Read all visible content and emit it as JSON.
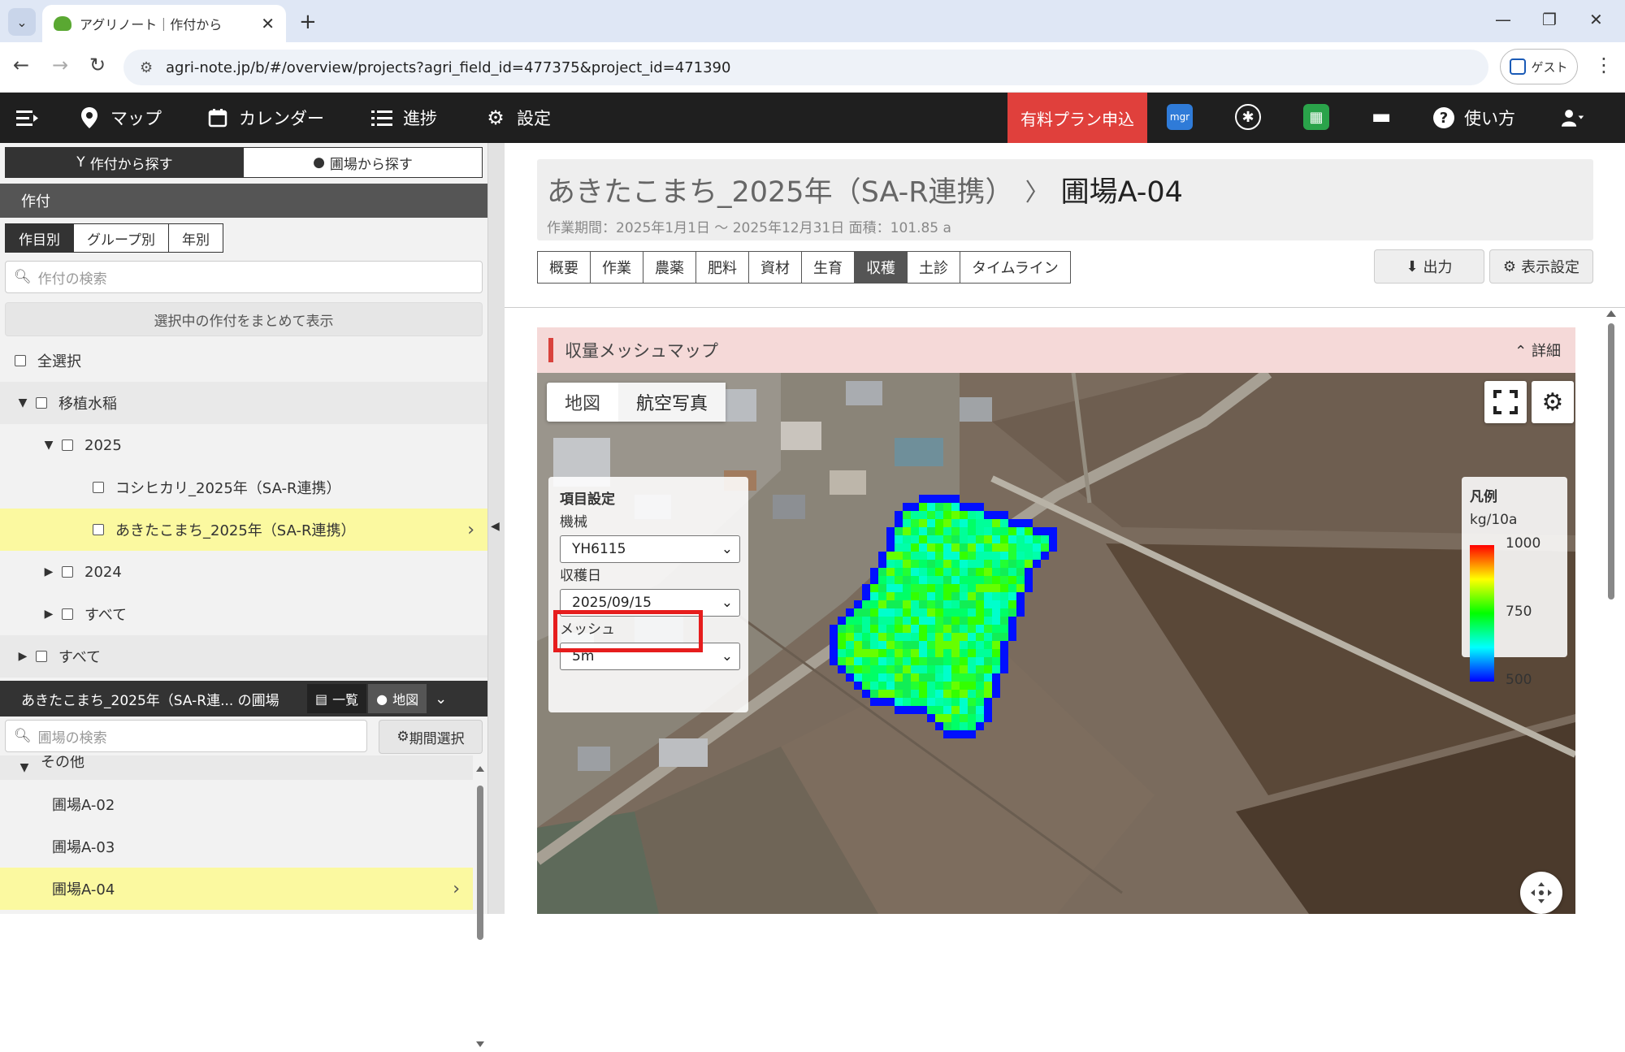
{
  "browser": {
    "tab_title": "アグリノート｜作付から",
    "url": "agri-note.jp/b/#/overview/projects?agri_field_id=477375&project_id=471390",
    "profile_label": "ゲスト"
  },
  "appbar": {
    "nav": [
      {
        "label": "マップ",
        "icon": "map-pin-icon"
      },
      {
        "label": "カレンダー",
        "icon": "calendar-icon"
      },
      {
        "label": "進捗",
        "icon": "progress-list-icon"
      },
      {
        "label": "設定",
        "icon": "gear-icon"
      }
    ],
    "paid_plan": "有料プラン申込",
    "help": "使い方",
    "accent_color": "#e0403c"
  },
  "left": {
    "search_modes": [
      "作付から探す",
      "圃場から探す"
    ],
    "crop_header": "作付",
    "group_tabs": [
      "作目別",
      "グループ別",
      "年別"
    ],
    "crop_search_placeholder": "作付の検索",
    "bulk_button": "選択中の作付をまとめて表示",
    "tree": [
      {
        "label": "全選択"
      },
      {
        "label": "移植水稲"
      },
      {
        "label": "2025"
      },
      {
        "label": "コシヒカリ_2025年（SA-R連携）"
      },
      {
        "label": "あきたこまち_2025年（SA-R連携）"
      },
      {
        "label": "2024"
      },
      {
        "label": "すべて"
      },
      {
        "label": "すべて"
      }
    ],
    "field_bar_title": "あきたこまち_2025年（SA-R連... の圃場",
    "field_bar_list": "一覧",
    "field_bar_map": "地図",
    "field_search_placeholder": "圃場の検索",
    "period_button": "期間選択",
    "field_group": "その他",
    "fields": [
      "圃場A-02",
      "圃場A-03",
      "圃場A-04"
    ]
  },
  "main": {
    "project_name": "あきたこまち_2025年（SA-R連携）",
    "field_name": "圃場A-04",
    "meta": "作業期間：2025年1月1日 〜 2025年12月31日  面積：101.85 a",
    "tabs": [
      "概要",
      "作業",
      "農薬",
      "肥料",
      "資材",
      "生育",
      "収穫",
      "土診",
      "タイムライン"
    ],
    "export_button": "出力",
    "display_settings_button": "表示設定",
    "panel_title": "収量メッシュマップ",
    "detail_toggle": "詳細",
    "map": {
      "mode_tabs": [
        "地図",
        "航空写真"
      ],
      "settings": {
        "title": "項目設定",
        "machine_label": "機械",
        "machine_value": "YH6115",
        "harvest_date_label": "収穫日",
        "harvest_date_value": "2025/09/15",
        "mesh_label": "メッシュ",
        "mesh_value": "5m"
      },
      "legend": {
        "title": "凡例",
        "unit": "kg/10a",
        "max": "1000",
        "mid": "750",
        "min": "500"
      }
    }
  }
}
